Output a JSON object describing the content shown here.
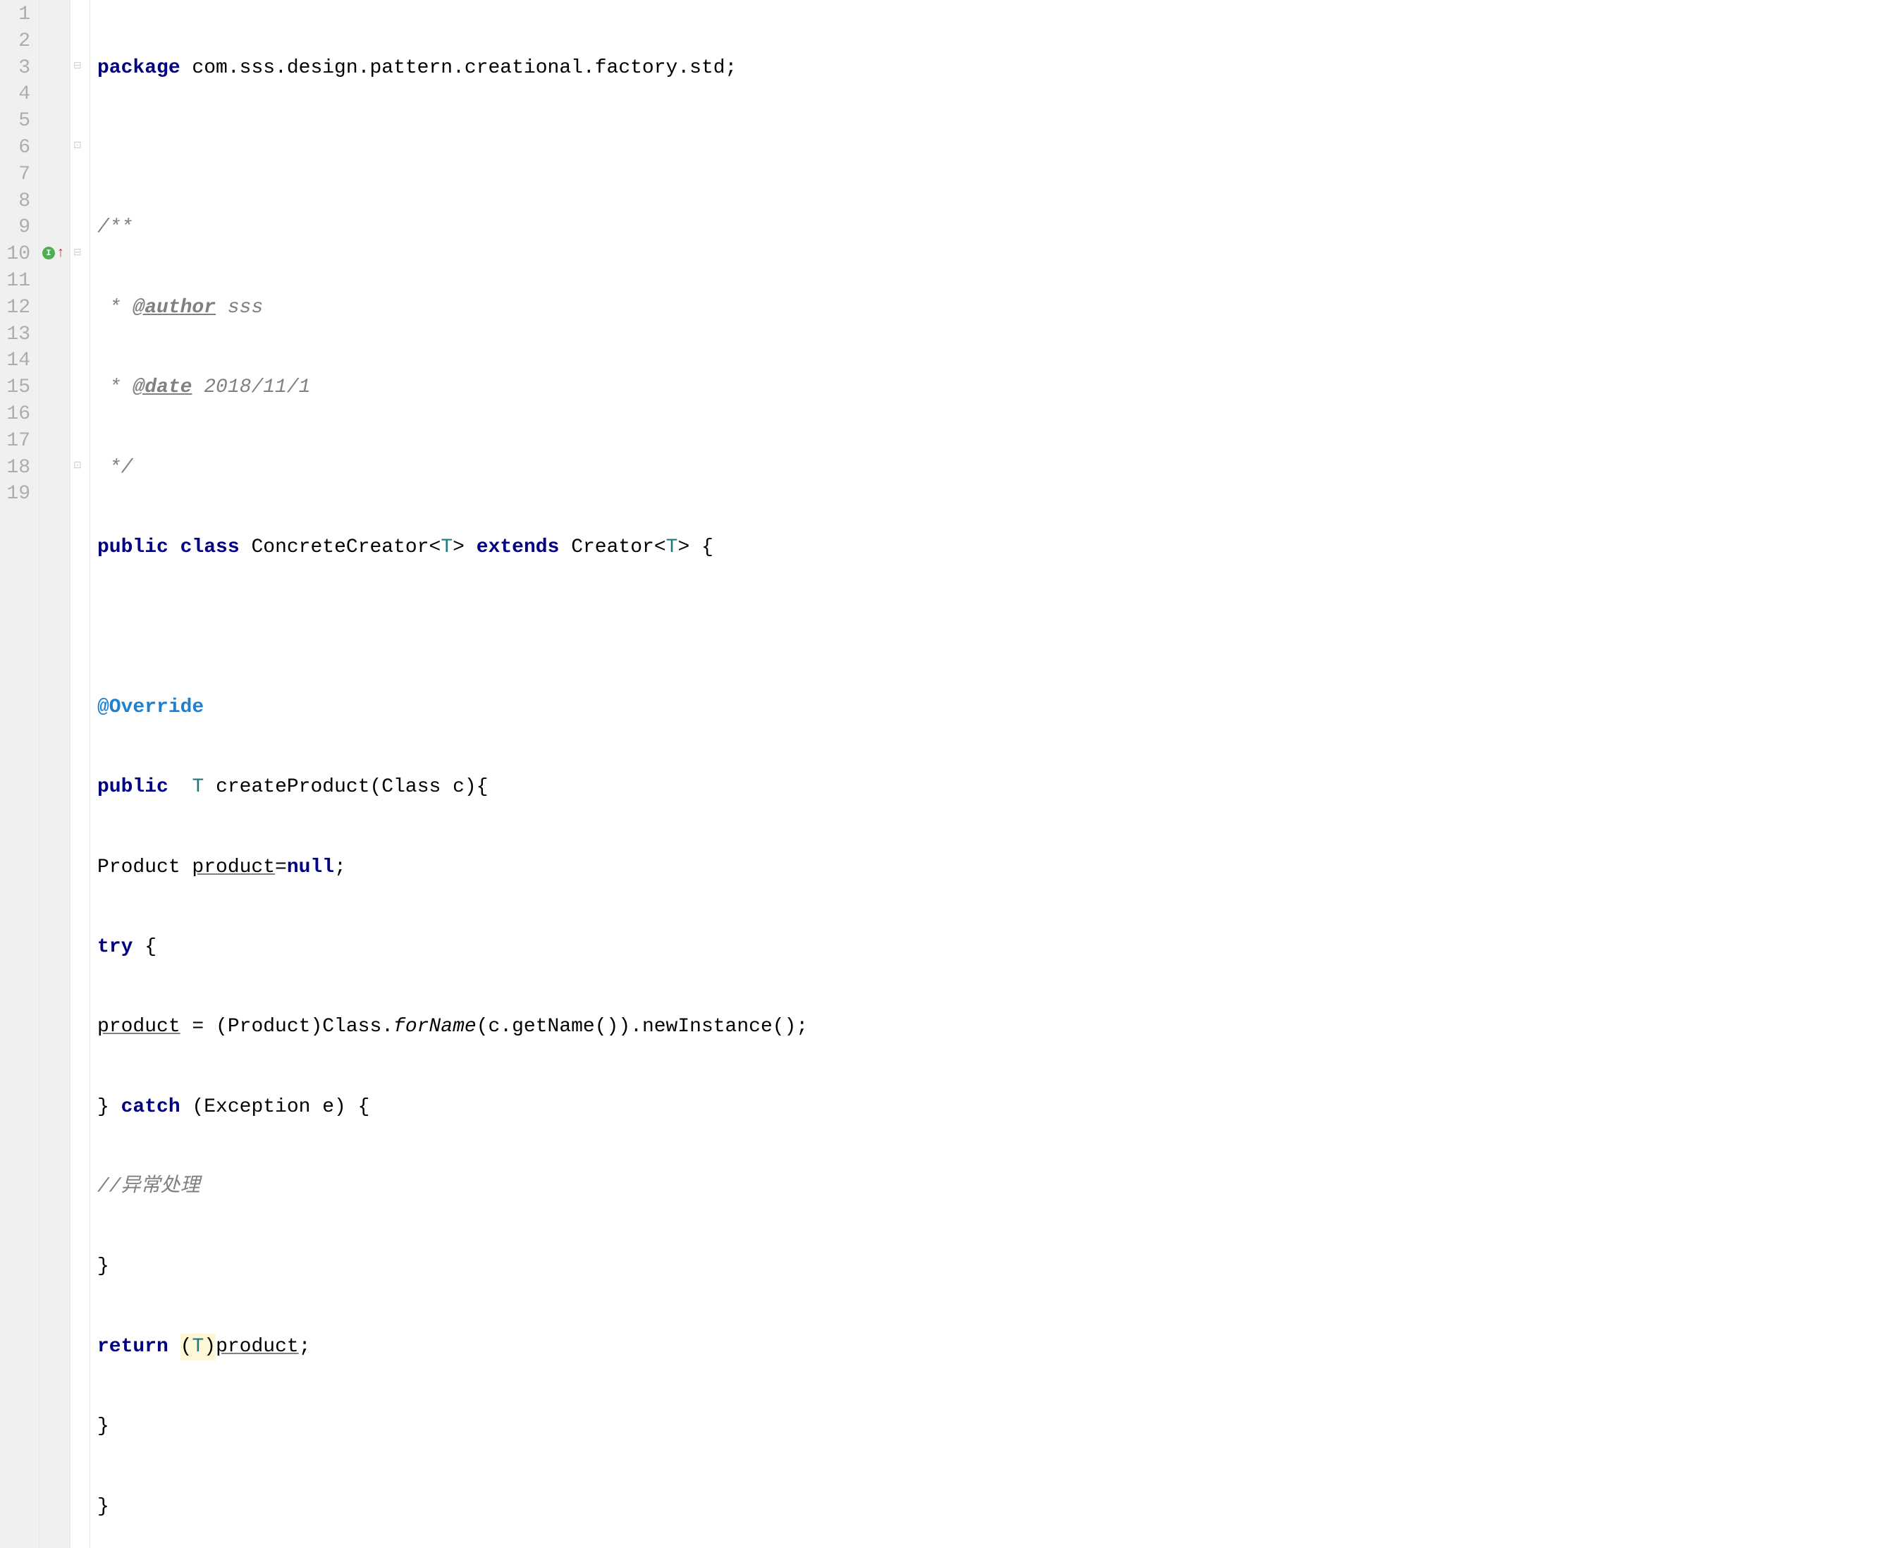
{
  "lines": {
    "numbers": [
      "1",
      "2",
      "3",
      "4",
      "5",
      "6",
      "7",
      "8",
      "9",
      "10",
      "11",
      "12",
      "13",
      "14",
      "15",
      "16",
      "17",
      "18",
      "19"
    ]
  },
  "code": {
    "l1": {
      "kw_package": "package",
      "pkg": " com.sss.design.pattern.creational.factory.std;"
    },
    "l3": {
      "c": "/**"
    },
    "l4": {
      "star": " * ",
      "tag": "@author",
      "txt": " sss"
    },
    "l5": {
      "star": " * ",
      "tag": "@date",
      "txt": " 2018/11/1"
    },
    "l6": {
      "c": " */"
    },
    "l7": {
      "kw_public": "public",
      "sp1": " ",
      "kw_class": "class",
      "sp2": " ",
      "cls": "ConcreteCreator",
      "lt": "<",
      "tp": "T",
      "gt": ">",
      "sp3": " ",
      "kw_extends": "extends",
      "sp4": " ",
      "sup": "Creator",
      "lt2": "<",
      "tp2": "T",
      "gt2": ">",
      "sp5": " {"
    },
    "l9": {
      "annot": "@Override"
    },
    "l10": {
      "kw_public": "public",
      "sp1": "  ",
      "tp": "T",
      "sp2": " ",
      "m": "createProduct",
      "args": "(Class c){"
    },
    "l11": {
      "pre": "Product ",
      "var": "product",
      "eq": "=",
      "kw_null": "null",
      "semi": ";"
    },
    "l12": {
      "kw_try": "try",
      "brace": " {"
    },
    "l13": {
      "var": "product",
      "eq": " = (Product)Class.",
      "fn": "forName",
      "mid": "(c.getName()).newInstance();"
    },
    "l14": {
      "close": "} ",
      "kw_catch": "catch",
      "args": " (Exception e) {"
    },
    "l15": {
      "c": "//异常处理"
    },
    "l16": {
      "close": "}"
    },
    "l17": {
      "kw_return": "return",
      "sp": " ",
      "cast_open": "(",
      "tp": "T",
      "cast_close": ")",
      "var": "product",
      "semi": ";"
    },
    "l18": {
      "close": "}"
    },
    "l19": {
      "close": "}"
    }
  }
}
